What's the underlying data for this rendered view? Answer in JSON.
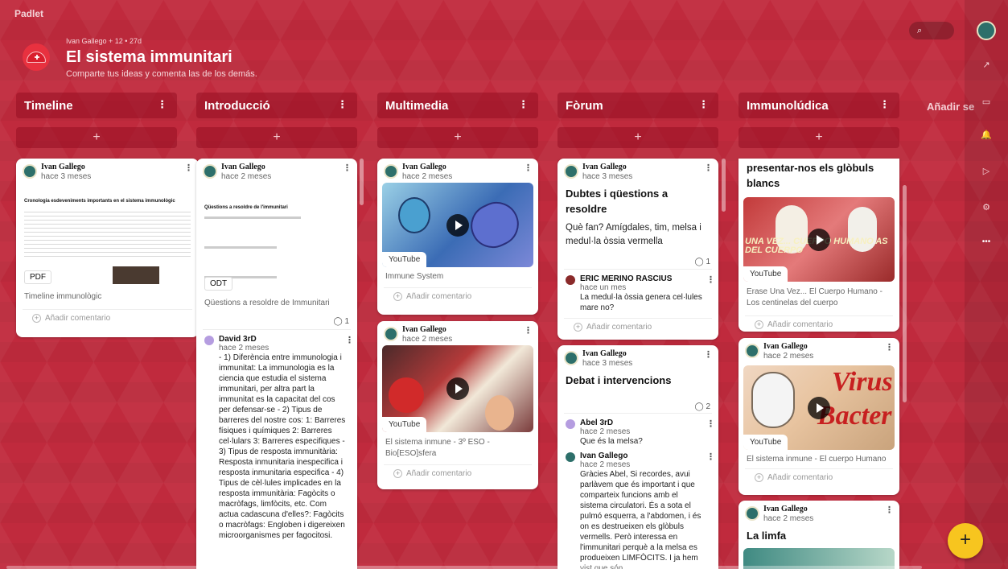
{
  "app": {
    "brand": "Padlet"
  },
  "header": {
    "meta": "Ivan Gallego + 12 • 27d",
    "title": "El sistema immunitari",
    "subtitle": "Comparte tus ideas y comenta las de los demás."
  },
  "search": {
    "icon": "search-icon",
    "glyph": "⌕"
  },
  "add_section": "Añadir se",
  "columns": [
    {
      "title": "Timeline"
    },
    {
      "title": "Introducció"
    },
    {
      "title": "Multimedia"
    },
    {
      "title": "Fòrum"
    },
    {
      "title": "Immunolúdica"
    }
  ],
  "common": {
    "add_comment": "Añadir comentario",
    "add": "+",
    "kebab": "⋮",
    "dots": "⋮"
  },
  "cards": {
    "timeline1": {
      "author": "Ivan Gallego",
      "time": "hace 3 meses",
      "doc_type": "PDF",
      "doc_title": "Cronologia esdeveniments importants en el sistema immunològic",
      "caption": "Timeline immunològic"
    },
    "intro1": {
      "author": "Ivan Gallego",
      "time": "hace 2 meses",
      "doc_type": "ODT",
      "doc_title": "Qüestions a resoldre de l'immunitari",
      "caption": "Qüestions a resoldre de Immunitari",
      "comments": "1",
      "comment": {
        "author": "David 3rD",
        "time": "hace 2 meses",
        "text": "- 1) Diferència entre immunologia i immunitat:    La immunologia es la ciencia que estudia el sistema immunitari, per altra part la immunitat es la capacitat del cos per defensar-se                          - 2) Tipus de barreres del nostre cos:                          1: Barreres físiques i químiques 2: Barreres cel·lulars 3: Barreres especifiques      -  3) Tipus de resposta immunitària:                      Resposta inmunitaria inespecifica i resposta inmunitaria especifica           - 4) Tipus de cèl·lules implicades en la resposta immunitària: Fagòcits o macròfags, limfòcits, etc. Com actua cadascuna d'elles?:                 Fagòcits o macròfags: Engloben i digereixen microorganismes per fagocitosi."
      }
    },
    "multi1": {
      "author": "Ivan Gallego",
      "time": "hace 2 meses",
      "tag": "YouTube",
      "caption": "Immune System"
    },
    "multi2": {
      "author": "Ivan Gallego",
      "time": "hace 2 meses",
      "tag": "YouTube",
      "caption": "El sistema inmune - 3º ESO - Bio[ESO]sfera"
    },
    "forum1": {
      "author": "Ivan Gallego",
      "time": "hace 3 meses",
      "title": "Dubtes i qüestions a resoldre",
      "body": "Què fan? Amígdales, tim, melsa i medul·la òssia vermella",
      "comments": "1",
      "comment": {
        "author": "ERIC MERINO RASCIUS",
        "time": "hace un mes",
        "text": "La medul·la òssia genera cel·lules mare no?"
      }
    },
    "forum2": {
      "author": "Ivan Gallego",
      "time": "hace 3 meses",
      "title": "Debat i intervencions",
      "comments": "2",
      "comment1": {
        "author": "Abel 3rD",
        "time": "hace 2 meses",
        "text": "Que és la melsa?"
      },
      "comment2": {
        "author": "Ivan Gallego",
        "time": "hace 2 meses",
        "text": "Gràcies Abel, Si recordes, avui parlàvem que és important i que comparteix funcions amb el sistema circulatori. És a sota el pulmó esquerra, a l'abdomen, i és on es destrueixen els glòbuls vermells. Però interessa en l'immunitari perquè a la melsa es produeixen LIMFÒCITS. I ja hem vist que són"
      }
    },
    "ludi1": {
      "title": "presentar-nos els glòbuls blancs",
      "tag": "YouTube",
      "overlay": "UNA VEZ... CUERPO HUMANO AS DEL CUERPO",
      "caption": "Erase Una Vez... El Cuerpo Humano - Los centinelas del cuerpo"
    },
    "ludi2": {
      "author": "Ivan Gallego",
      "time": "hace 2 meses",
      "tag": "YouTube",
      "overlay1": "Virus",
      "overlay2": "Bacter",
      "caption": "El sistema inmune - El cuerpo Humano"
    },
    "ludi3": {
      "author": "Ivan Gallego",
      "time": "hace 2 meses",
      "title": "La limfa"
    }
  },
  "rail": {
    "share": "↗",
    "slideshow": "▭",
    "bell": "🔔",
    "play": "▷",
    "gear": "⚙",
    "more": "•••"
  },
  "fab": "+",
  "colors": {
    "background": "#c02a3d",
    "fab": "#f7c51f"
  }
}
